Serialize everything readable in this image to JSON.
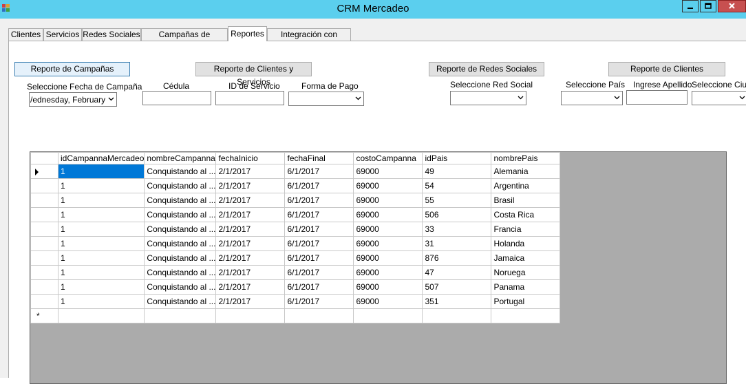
{
  "window": {
    "title": "CRM Mercadeo"
  },
  "tabs": [
    {
      "label": "Clientes"
    },
    {
      "label": "Servicios"
    },
    {
      "label": "Redes Sociales"
    },
    {
      "label": "Campañas de Mercadeo"
    },
    {
      "label": "Reportes"
    },
    {
      "label": "Integración con Ventas"
    }
  ],
  "active_tab": "Reportes",
  "reports": {
    "campaign_report_button": "Reporte de Campañas",
    "campaign_date_label": "Seleccione Fecha de Campaña",
    "campaign_date_value": "/ednesday,   February",
    "clients_services_button": "Reporte de Clientes y Servicios",
    "cedula_label": "Cédula",
    "service_id_label": "ID de Servicio",
    "payment_label": "Forma de Pago",
    "social_report_button": "Reporte de Redes Sociales",
    "social_label": "Seleccione Red Social",
    "clients_report_button": "Reporte de Clientes",
    "country_label": "Seleccione País",
    "surname_label": "Ingrese Apellido",
    "city_label": "Seleccione Ciuda"
  },
  "grid": {
    "columns": [
      "idCampannaMercadeo",
      "nombreCampanna",
      "fechaInicio",
      "fechaFinal",
      "costoCampanna",
      "idPais",
      "nombrePais"
    ],
    "rows": [
      [
        "1",
        "Conquistando al ...",
        "2/1/2017",
        "6/1/2017",
        "69000",
        "49",
        "Alemania"
      ],
      [
        "1",
        "Conquistando al ...",
        "2/1/2017",
        "6/1/2017",
        "69000",
        "54",
        "Argentina"
      ],
      [
        "1",
        "Conquistando al ...",
        "2/1/2017",
        "6/1/2017",
        "69000",
        "55",
        "Brasil"
      ],
      [
        "1",
        "Conquistando al ...",
        "2/1/2017",
        "6/1/2017",
        "69000",
        "506",
        "Costa Rica"
      ],
      [
        "1",
        "Conquistando al ...",
        "2/1/2017",
        "6/1/2017",
        "69000",
        "33",
        "Francia"
      ],
      [
        "1",
        "Conquistando al ...",
        "2/1/2017",
        "6/1/2017",
        "69000",
        "31",
        "Holanda"
      ],
      [
        "1",
        "Conquistando al ...",
        "2/1/2017",
        "6/1/2017",
        "69000",
        "876",
        "Jamaica"
      ],
      [
        "1",
        "Conquistando al ...",
        "2/1/2017",
        "6/1/2017",
        "69000",
        "47",
        "Noruega"
      ],
      [
        "1",
        "Conquistando al ...",
        "2/1/2017",
        "6/1/2017",
        "69000",
        "507",
        "Panama"
      ],
      [
        "1",
        "Conquistando al ...",
        "2/1/2017",
        "6/1/2017",
        "69000",
        "351",
        "Portugal"
      ]
    ],
    "new_row_marker": "*",
    "selected_row_icon": "current-row-arrow-icon"
  },
  "icons": {
    "app": "app-icon",
    "minimize": "minimize-icon",
    "maximize": "maximize-icon",
    "close": "close-icon",
    "dropdown": "chevron-down-icon"
  },
  "colors": {
    "titlebar": "#5bcfee",
    "close_button": "#c75050",
    "grid_background": "#ababab",
    "selection": "#0078d7"
  }
}
